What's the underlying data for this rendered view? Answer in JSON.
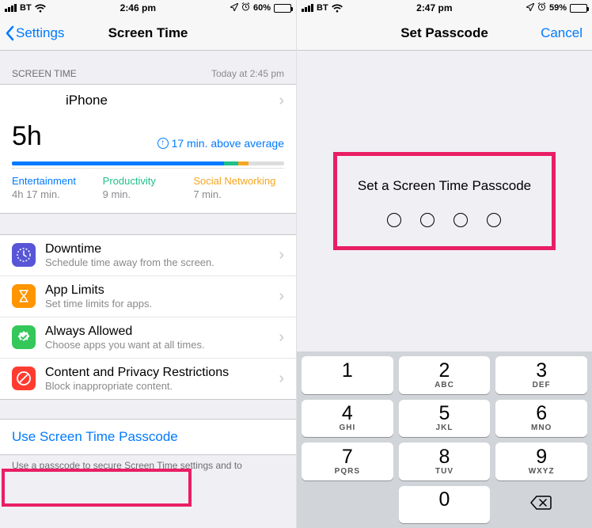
{
  "left": {
    "status": {
      "carrier": "BT",
      "time": "2:46 pm",
      "battery_pct": "60%",
      "battery_fill": 60
    },
    "nav": {
      "back": "Settings",
      "title": "Screen Time"
    },
    "screen_time_header": {
      "label": "SCREEN TIME",
      "asof": "Today at 2:45 pm"
    },
    "device": "iPhone",
    "total": "5h",
    "above_average": "17 min. above average",
    "categories": {
      "entertainment": {
        "name": "Entertainment",
        "value": "4h 17 min."
      },
      "productivity": {
        "name": "Productivity",
        "value": "9 min."
      },
      "social": {
        "name": "Social Networking",
        "value": "7 min."
      }
    },
    "menu": {
      "downtime": {
        "title": "Downtime",
        "sub": "Schedule time away from the screen."
      },
      "applimits": {
        "title": "App Limits",
        "sub": "Set time limits for apps."
      },
      "allowed": {
        "title": "Always Allowed",
        "sub": "Choose apps you want at all times."
      },
      "content": {
        "title": "Content and Privacy Restrictions",
        "sub": "Block inappropriate content."
      }
    },
    "passcode_link": "Use Screen Time Passcode",
    "footer": "Use a passcode to secure Screen Time settings and to"
  },
  "right": {
    "status": {
      "carrier": "BT",
      "time": "2:47 pm",
      "battery_pct": "59%",
      "battery_fill": 59
    },
    "nav": {
      "title": "Set Passcode",
      "cancel": "Cancel"
    },
    "prompt": "Set a Screen Time Passcode",
    "keypad": [
      {
        "n": "1",
        "l": ""
      },
      {
        "n": "2",
        "l": "ABC"
      },
      {
        "n": "3",
        "l": "DEF"
      },
      {
        "n": "4",
        "l": "GHI"
      },
      {
        "n": "5",
        "l": "JKL"
      },
      {
        "n": "6",
        "l": "MNO"
      },
      {
        "n": "7",
        "l": "PQRS"
      },
      {
        "n": "8",
        "l": "TUV"
      },
      {
        "n": "9",
        "l": "WXYZ"
      },
      {
        "n": "",
        "l": ""
      },
      {
        "n": "0",
        "l": ""
      }
    ]
  },
  "chart_data": {
    "type": "bar",
    "title": "Screen Time today",
    "total_minutes": 300,
    "series": [
      {
        "name": "Entertainment",
        "minutes": 257,
        "color": "#007aff"
      },
      {
        "name": "Productivity",
        "minutes": 9,
        "color": "#20bf8b"
      },
      {
        "name": "Social Networking",
        "minutes": 7,
        "color": "#f5a623"
      }
    ]
  }
}
